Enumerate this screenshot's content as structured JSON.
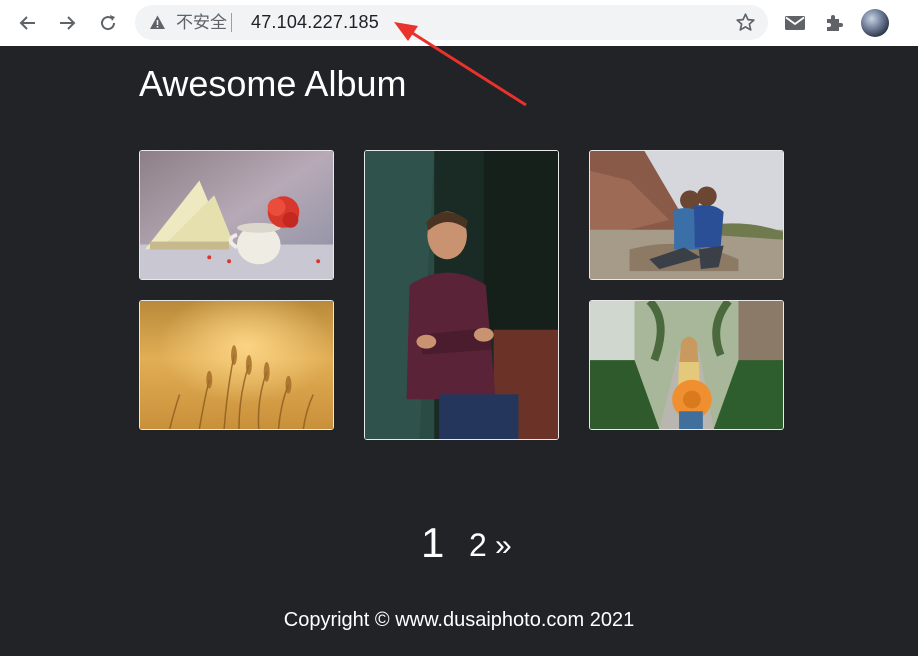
{
  "browser": {
    "security_label": "不安全",
    "url": "47.104.227.185",
    "nav": {
      "back": "back-arrow-icon",
      "forward": "forward-arrow-icon",
      "reload": "reload-icon"
    },
    "extensions": [
      "mail-icon",
      "puzzle-icon"
    ]
  },
  "page": {
    "title": "Awesome Album",
    "photos": [
      {
        "subject": "Tea cup with red carnation and open book"
      },
      {
        "subject": "Smiling man in maroon sweater leaning against fence"
      },
      {
        "subject": "Two children hugging on a dirt road"
      },
      {
        "subject": "Golden wheat field"
      },
      {
        "subject": "Woman holding an orange hat on a garden path"
      }
    ],
    "pagination": {
      "current": "1",
      "next_page": "2",
      "next_arrow": "»"
    },
    "footer": "Copyright © www.dusaiphoto.com 2021"
  },
  "colors": {
    "page_background": "#212327",
    "toolbar_background": "#ffffff",
    "omnibox_background": "#f1f3f4",
    "annotation_arrow": "#e8322b"
  }
}
